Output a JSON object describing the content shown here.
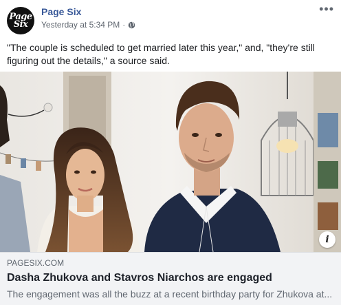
{
  "header": {
    "avatar_line1": "Page",
    "avatar_line2": "Six",
    "page_name": "Page Six",
    "timestamp": "Yesterday at 5:34 PM",
    "separator": "·",
    "audience_icon": "globe-icon",
    "more_icon": "more-horizontal-icon"
  },
  "post": {
    "message": "\"The couple is scheduled to get married later this year,\" and, \"they're still figuring out the details,\" a source said."
  },
  "link": {
    "domain": "PAGESIX.COM",
    "headline": "Dasha Zhukova and Stavros Niarchos are engaged",
    "description": "The engagement was all the buzz at a recent birthday party for Zhukova at...",
    "info_icon": "info-icon",
    "info_glyph": "i"
  },
  "colors": {
    "brand_link": "#385898",
    "muted": "#606770",
    "link_bg": "#f2f3f5"
  }
}
